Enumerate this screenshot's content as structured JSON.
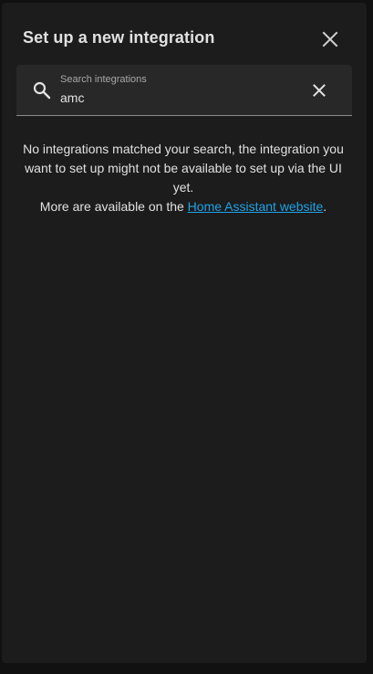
{
  "dialog": {
    "title": "Set up a new integration",
    "close_icon": "close-icon"
  },
  "search": {
    "label": "Search integrations",
    "value": "amc",
    "search_icon": "search-icon",
    "clear_icon": "clear-icon"
  },
  "message": {
    "no_results": "No integrations matched your search, the integration you want to set up might not be available to set up via the UI yet.",
    "more_prefix": "More are available on the ",
    "link_text": "Home Assistant website",
    "more_suffix": "."
  },
  "colors": {
    "background": "#1c1c1c",
    "text": "#e1e1e1",
    "link": "#1fa2e6",
    "field": "#282828"
  }
}
